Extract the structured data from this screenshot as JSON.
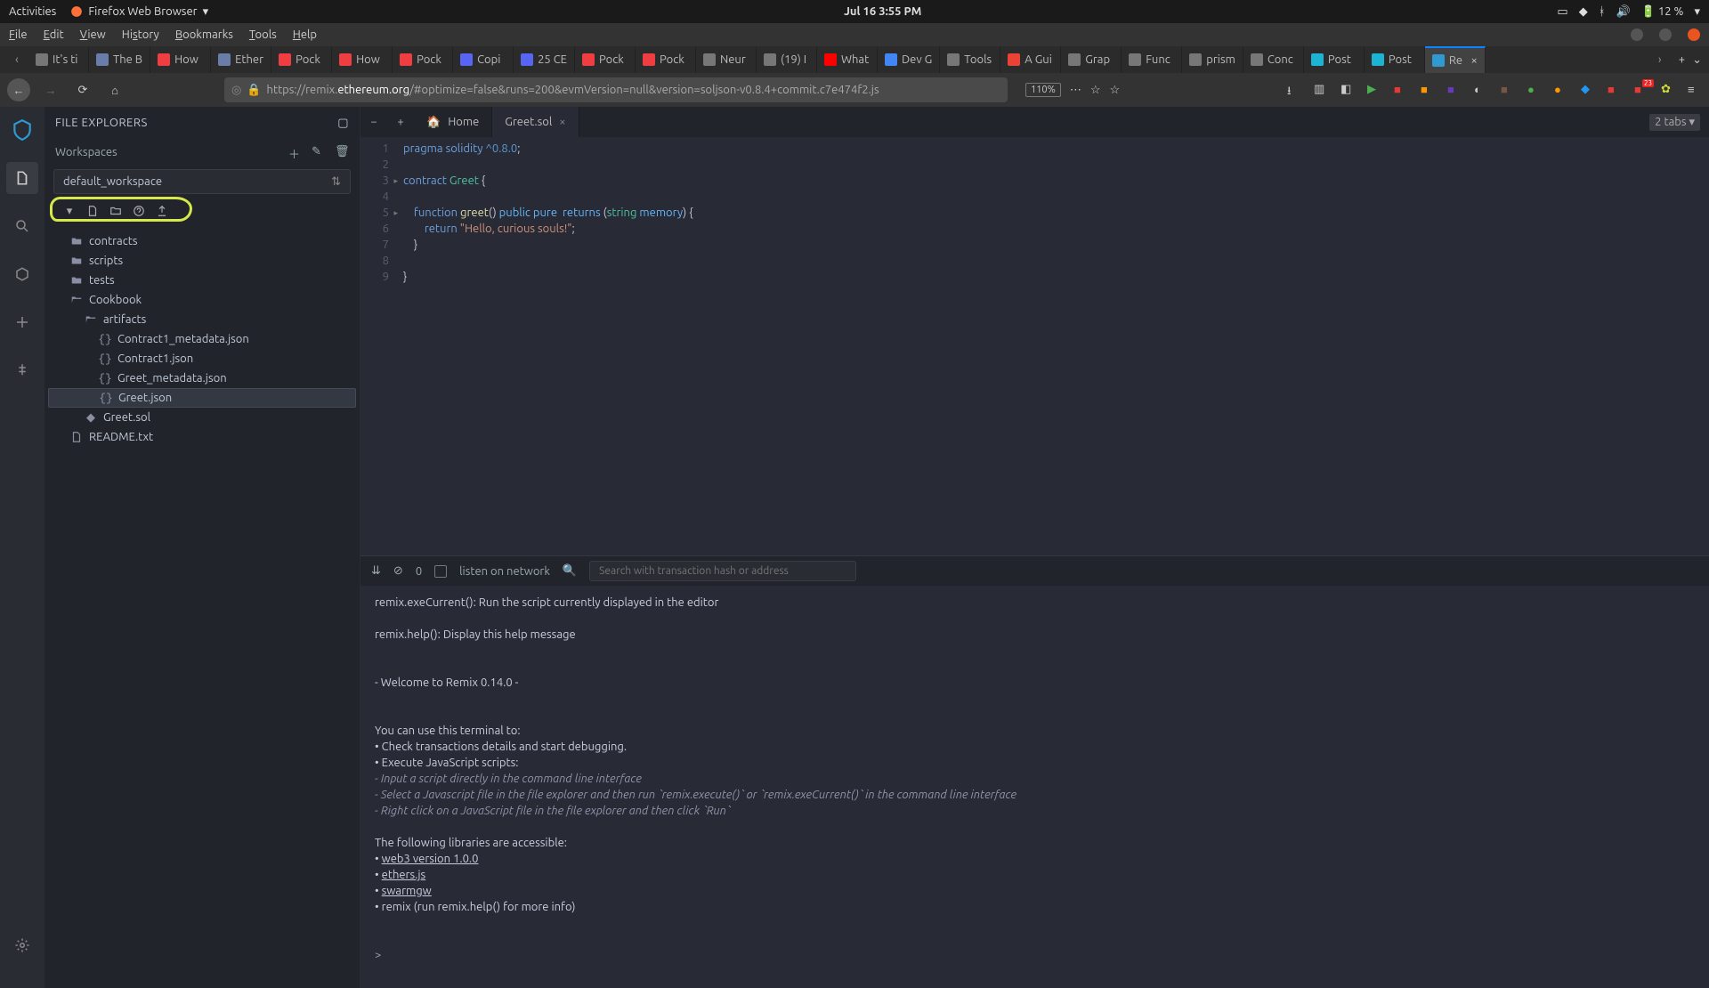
{
  "topbar": {
    "activities": "Activities",
    "browser": "Firefox Web Browser",
    "datetime": "Jul 16   3:55 PM",
    "battery": "12 %"
  },
  "menubar": {
    "items": [
      "File",
      "Edit",
      "View",
      "History",
      "Bookmarks",
      "Tools",
      "Help"
    ]
  },
  "tabs": {
    "list": [
      {
        "label": "It's ti",
        "icon": "#777"
      },
      {
        "label": "The B",
        "icon": "#6a7da8"
      },
      {
        "label": "How",
        "icon": "#ef3e42"
      },
      {
        "label": "Ether",
        "icon": "#6a7da8"
      },
      {
        "label": "Pock",
        "icon": "#ef3e42"
      },
      {
        "label": "How",
        "icon": "#ef3e42"
      },
      {
        "label": "Pock",
        "icon": "#ef3e42"
      },
      {
        "label": "Copi",
        "icon": "#5865f2"
      },
      {
        "label": "25 CE",
        "icon": "#5865f2"
      },
      {
        "label": "Pock",
        "icon": "#ef3e42"
      },
      {
        "label": "Pock",
        "icon": "#ef3e42"
      },
      {
        "label": "Neur",
        "icon": "#777"
      },
      {
        "label": "(19) I",
        "icon": "#777"
      },
      {
        "label": "What",
        "icon": "#ff0000"
      },
      {
        "label": "Dev G",
        "icon": "#4285f4"
      },
      {
        "label": "Tools",
        "icon": "#777"
      },
      {
        "label": "A Gui",
        "icon": "#ea4335"
      },
      {
        "label": "Grap",
        "icon": "#777"
      },
      {
        "label": "Func",
        "icon": "#777"
      },
      {
        "label": "prism",
        "icon": "#777"
      },
      {
        "label": "Conc",
        "icon": "#777"
      },
      {
        "label": "Post",
        "icon": "#1db4d4"
      },
      {
        "label": "Post",
        "icon": "#1db4d4"
      },
      {
        "label": "Re",
        "icon": "#2f9ad1",
        "active": true
      }
    ]
  },
  "urlbar": {
    "prefix": "https://remix.",
    "host": "ethereum.org",
    "rest": "/#optimize=false&runs=200&evmVersion=null&version=soljson-v0.8.4+commit.c7e474f2.js",
    "zoom": "110%"
  },
  "toolbar_badge": "23",
  "fe": {
    "title": "FILE EXPLORERS",
    "workspaces": "Workspaces",
    "workspace_name": "default_workspace",
    "tree": [
      {
        "l": "contracts",
        "t": "folder",
        "d": 0
      },
      {
        "l": "scripts",
        "t": "folder",
        "d": 0
      },
      {
        "l": "tests",
        "t": "folder",
        "d": 0
      },
      {
        "l": "Cookbook",
        "t": "folder-open",
        "d": 0
      },
      {
        "l": "artifacts",
        "t": "folder-open",
        "d": 1
      },
      {
        "l": "Contract1_metadata.json",
        "t": "json",
        "d": 2
      },
      {
        "l": "Contract1.json",
        "t": "json",
        "d": 2
      },
      {
        "l": "Greet_metadata.json",
        "t": "json",
        "d": 2
      },
      {
        "l": "Greet.json",
        "t": "json",
        "d": 2,
        "sel": true
      },
      {
        "l": "Greet.sol",
        "t": "sol",
        "d": 1
      },
      {
        "l": "README.txt",
        "t": "txt",
        "d": 0
      }
    ]
  },
  "editor": {
    "home": "Home",
    "file": "Greet.sol",
    "tabsbadge": "2 tabs ▾",
    "lines": [
      1,
      2,
      3,
      4,
      5,
      6,
      7,
      8,
      9
    ]
  },
  "termbar": {
    "count": "0",
    "listen": "listen on network",
    "search_ph": "Search with transaction hash or address"
  },
  "terminal": {
    "l1": "remix.exeCurrent(): Run the script currently displayed in the editor",
    "l2": "remix.help(): Display this help message",
    "welcome": " - Welcome to Remix 0.14.0 - ",
    "use": "You can use this terminal to:",
    "b1": "Check transactions details and start debugging.",
    "b2": "Execute JavaScript scripts:",
    "s1": "Input a script directly in the command line interface",
    "s2": "Select a Javascript file in the file explorer and then run `remix.execute()` or `remix.exeCurrent()` in the command line interface",
    "s3": "Right click on a JavaScript file in the file explorer and then click `Run`",
    "libs": "The following libraries are accessible:",
    "lib1": "web3 version 1.0.0",
    "lib2": "ethers.js",
    "lib3": "swarmgw",
    "lib4": "remix (run remix.help() for more info)",
    "prompt": ">"
  }
}
